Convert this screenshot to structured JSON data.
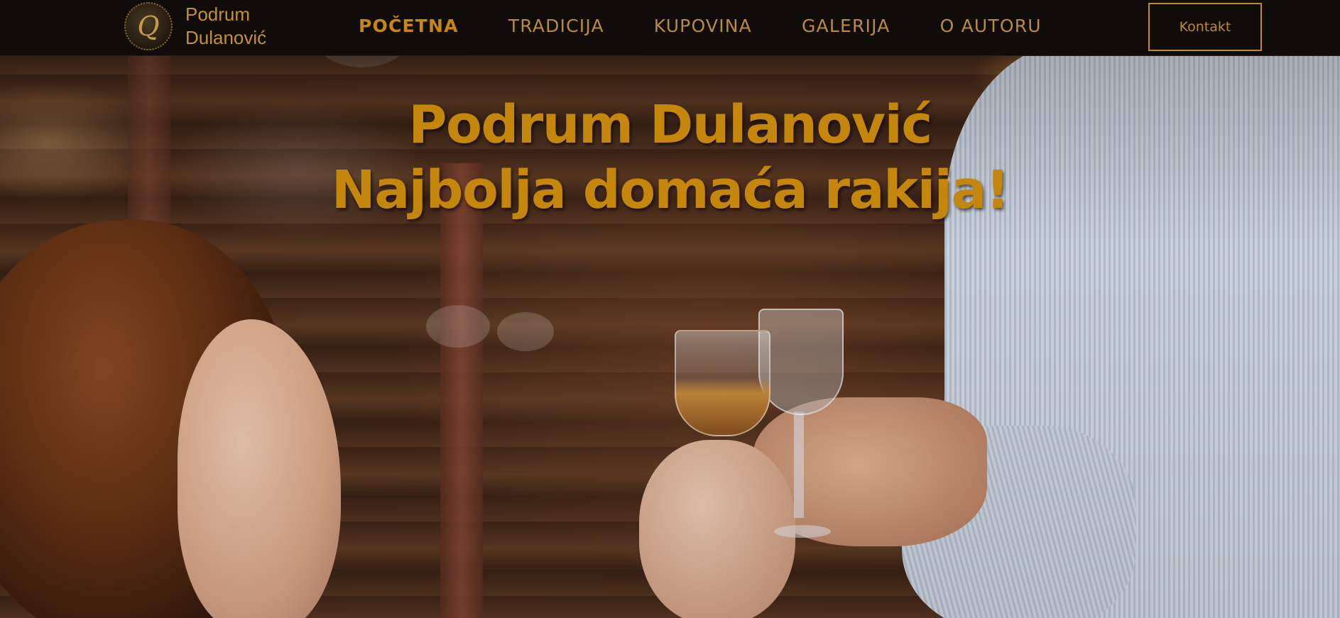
{
  "brand": {
    "logo_letter": "Q",
    "line1": "Podrum",
    "line2": "Dulanović"
  },
  "nav": {
    "items": [
      {
        "label": "POČETNA",
        "active": true
      },
      {
        "label": "TRADICIJA",
        "active": false
      },
      {
        "label": "KUPOVINA",
        "active": false
      },
      {
        "label": "GALERIJA",
        "active": false
      },
      {
        "label": "O AUTORU",
        "active": false
      }
    ],
    "contact_label": "Kontakt"
  },
  "hero": {
    "title_line1": "Podrum Dulanović",
    "title_line2": "Najbolja domaća rakija!"
  },
  "colors": {
    "accent_gold": "#c5860c",
    "nav_text": "#b98a3f",
    "nav_bg": "#0f0c0a"
  }
}
